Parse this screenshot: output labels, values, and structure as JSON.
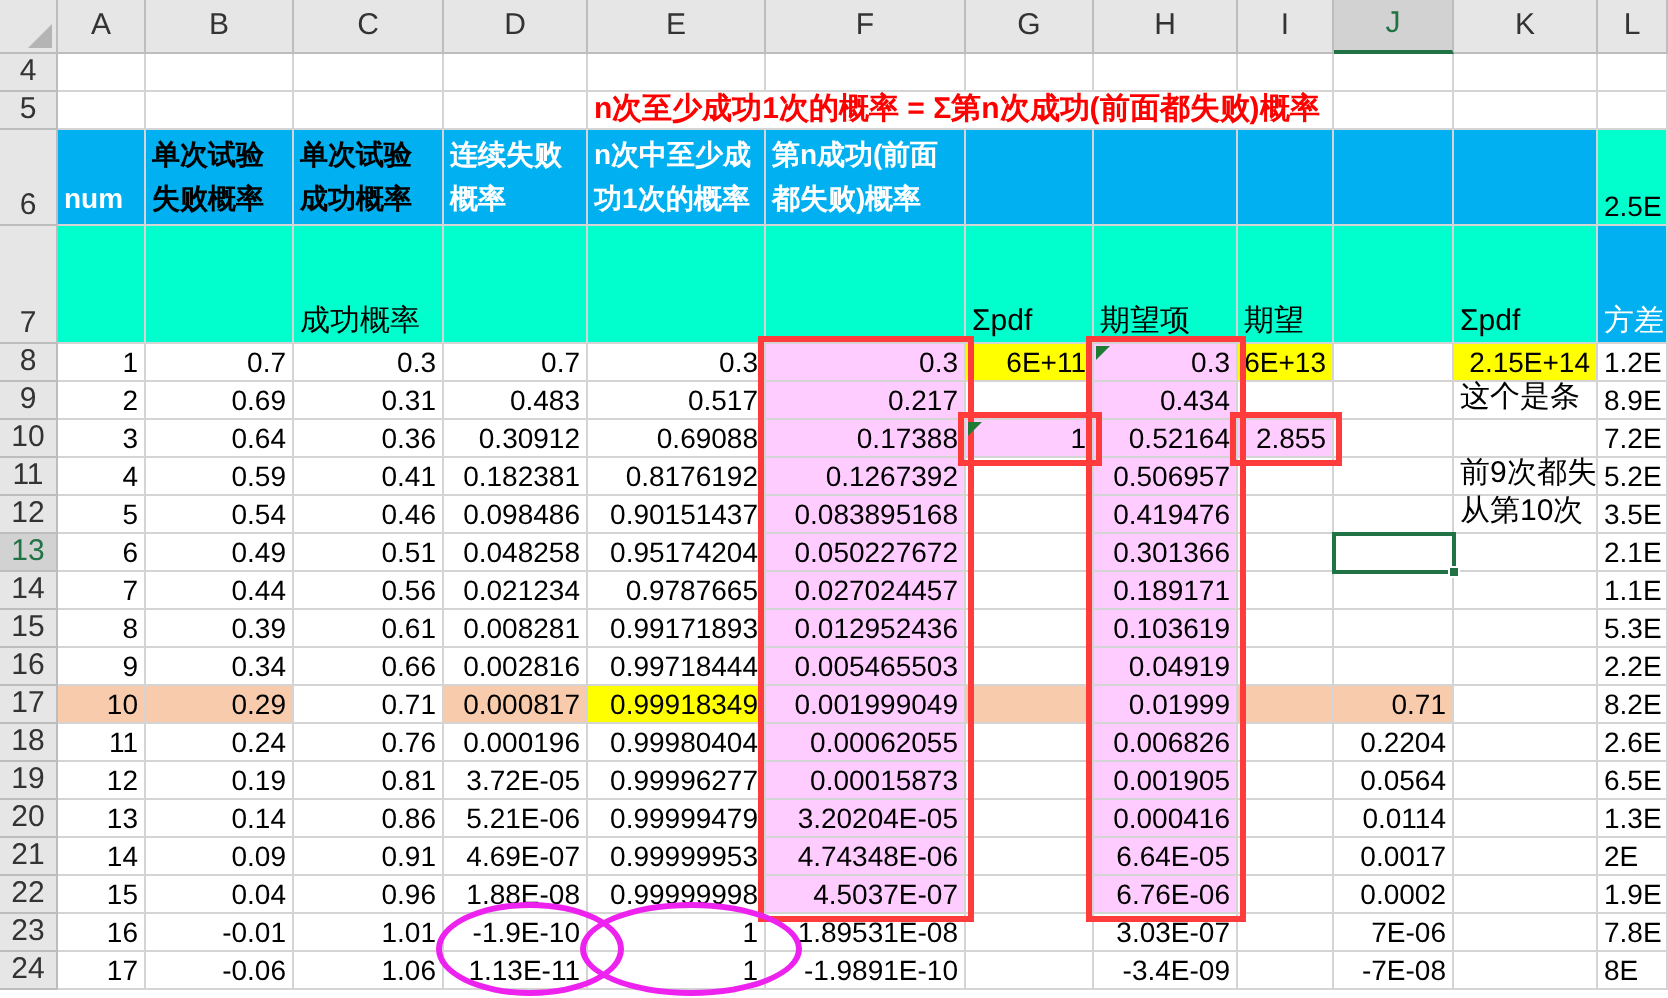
{
  "columns": [
    {
      "label": "A",
      "selected": false
    },
    {
      "label": "B",
      "selected": false
    },
    {
      "label": "C",
      "selected": false
    },
    {
      "label": "D",
      "selected": false
    },
    {
      "label": "E",
      "selected": false
    },
    {
      "label": "F",
      "selected": false
    },
    {
      "label": "G",
      "selected": false
    },
    {
      "label": "H",
      "selected": false
    },
    {
      "label": "I",
      "selected": false
    },
    {
      "label": "J",
      "selected": true
    },
    {
      "label": "K",
      "selected": false
    },
    {
      "label": "L",
      "selected": false
    }
  ],
  "rows": [
    {
      "num": "4",
      "selected": false,
      "cells": []
    },
    {
      "num": "5",
      "selected": false,
      "cells": [
        null,
        null,
        null,
        null,
        {
          "text": "n次至少成功1次的概率 = Σ第n次成功(前面都失败)概率",
          "kind": "title"
        }
      ]
    },
    {
      "num": "6",
      "selected": false,
      "cells": [
        {
          "text": "num",
          "kind": "header",
          "light_text": true,
          "color": "#00b0f0"
        },
        {
          "text": "单次试验失败概率",
          "kind": "header",
          "light_text": false,
          "color": "#00b0f0"
        },
        {
          "text": "单次试验成功概率",
          "kind": "header",
          "light_text": false,
          "color": "#00b0f0"
        },
        {
          "text": "连续失败概率",
          "kind": "header",
          "light_text": true,
          "color": "#00b0f0"
        },
        {
          "text": "n次中至少成功1次的概率",
          "kind": "header",
          "light_text": true,
          "color": "#00b0f0"
        },
        {
          "text": "第n成功(前面都失败)概率",
          "kind": "header",
          "light_text": true,
          "color": "#00b0f0"
        },
        {
          "color": "#00b0f0"
        },
        {
          "color": "#00b0f0"
        },
        {
          "color": "#00b0f0"
        },
        {
          "color": "#00b0f0"
        },
        {
          "color": "#00b0f0"
        },
        {
          "text": "2.5E",
          "kind": "clipped",
          "color": "#00ffcc"
        }
      ]
    },
    {
      "num": "7",
      "selected": false,
      "cells": [
        {
          "color": "#00ffcc"
        },
        {
          "color": "#00ffcc"
        },
        {
          "text": "成功概率",
          "kind": "label",
          "color": "#00ffcc"
        },
        {
          "color": "#00ffcc"
        },
        {
          "color": "#00ffcc"
        },
        {
          "color": "#00ffcc"
        },
        {
          "text": "Σpdf",
          "kind": "label",
          "color": "#00ffcc"
        },
        {
          "text": "期望项",
          "kind": "label",
          "color": "#00ffcc"
        },
        {
          "text": "期望",
          "kind": "label",
          "color": "#00ffcc"
        },
        {
          "color": "#00ffcc"
        },
        {
          "text": "Σpdf",
          "kind": "label",
          "color": "#00ffcc"
        },
        {
          "text": "方差",
          "kind": "label",
          "color": "#00b0f0",
          "light_text": true
        }
      ]
    },
    {
      "num": "8",
      "selected": false,
      "cells": [
        {
          "text": "1"
        },
        {
          "text": "0.7"
        },
        {
          "text": "0.3"
        },
        {
          "text": "0.7"
        },
        {
          "text": "0.3"
        },
        {
          "text": "0.3",
          "color": "#ffccff",
          "boxed": true
        },
        {
          "text": "6E+11",
          "color": "#ffff00"
        },
        {
          "text": "0.3",
          "color": "#ffccff",
          "flag": true,
          "boxed": true
        },
        {
          "text": "6E+13",
          "color": "#ffff00"
        },
        null,
        {
          "text": "2.15E+14",
          "color": "#ffff00"
        },
        {
          "text": "1.2E",
          "kind": "clipped"
        }
      ]
    },
    {
      "num": "9",
      "selected": false,
      "cells": [
        {
          "text": "2"
        },
        {
          "text": "0.69"
        },
        {
          "text": "0.31"
        },
        {
          "text": "0.483"
        },
        {
          "text": "0.517"
        },
        {
          "text": "0.217",
          "color": "#ffccff",
          "boxed": true
        },
        null,
        {
          "text": "0.434",
          "color": "#ffccff",
          "boxed": true
        },
        null,
        null,
        {
          "text": "这个是条",
          "kind": "label"
        },
        {
          "text": "8.9E",
          "kind": "clipped"
        }
      ]
    },
    {
      "num": "10",
      "selected": false,
      "cells": [
        {
          "text": "3"
        },
        {
          "text": "0.64"
        },
        {
          "text": "0.36"
        },
        {
          "text": "0.30912"
        },
        {
          "text": "0.69088"
        },
        {
          "text": "0.17388",
          "color": "#ffccff",
          "boxed": true
        },
        {
          "text": "1",
          "color": "#ffccff",
          "flag": true,
          "boxed": true
        },
        {
          "text": "0.52164",
          "color": "#ffccff",
          "boxed": true
        },
        {
          "text": "2.855",
          "color": "#ffccff",
          "boxed": true
        },
        null,
        null,
        {
          "text": "7.2E",
          "kind": "clipped"
        }
      ]
    },
    {
      "num": "11",
      "selected": false,
      "cells": [
        {
          "text": "4"
        },
        {
          "text": "0.59"
        },
        {
          "text": "0.41"
        },
        {
          "text": "0.182381"
        },
        {
          "text": "0.8176192"
        },
        {
          "text": "0.1267392",
          "color": "#ffccff",
          "boxed": true
        },
        null,
        {
          "text": "0.506957",
          "color": "#ffccff",
          "boxed": true
        },
        null,
        null,
        {
          "text": "前9次都失",
          "kind": "label"
        },
        {
          "text": "5.2E",
          "kind": "clipped"
        }
      ]
    },
    {
      "num": "12",
      "selected": false,
      "cells": [
        {
          "text": "5"
        },
        {
          "text": "0.54"
        },
        {
          "text": "0.46"
        },
        {
          "text": "0.098486"
        },
        {
          "text": "0.90151437"
        },
        {
          "text": "0.083895168",
          "color": "#ffccff",
          "boxed": true
        },
        null,
        {
          "text": "0.419476",
          "color": "#ffccff",
          "boxed": true
        },
        null,
        null,
        {
          "text": "从第10次",
          "kind": "label"
        },
        {
          "text": "3.5E",
          "kind": "clipped"
        }
      ]
    },
    {
      "num": "13",
      "selected": true,
      "cells": [
        {
          "text": "6"
        },
        {
          "text": "0.49"
        },
        {
          "text": "0.51"
        },
        {
          "text": "0.048258"
        },
        {
          "text": "0.95174204"
        },
        {
          "text": "0.050227672",
          "color": "#ffccff",
          "boxed": true
        },
        null,
        {
          "text": "0.301366",
          "color": "#ffccff",
          "boxed": true
        },
        null,
        {
          "selected": true
        },
        null,
        {
          "text": "2.1E",
          "kind": "clipped"
        }
      ]
    },
    {
      "num": "14",
      "selected": false,
      "cells": [
        {
          "text": "7"
        },
        {
          "text": "0.44"
        },
        {
          "text": "0.56"
        },
        {
          "text": "0.021234"
        },
        {
          "text": "0.9787665"
        },
        {
          "text": "0.027024457",
          "color": "#ffccff",
          "boxed": true
        },
        null,
        {
          "text": "0.189171",
          "color": "#ffccff",
          "boxed": true
        },
        null,
        null,
        null,
        {
          "text": "1.1E",
          "kind": "clipped"
        }
      ]
    },
    {
      "num": "15",
      "selected": false,
      "cells": [
        {
          "text": "8"
        },
        {
          "text": "0.39"
        },
        {
          "text": "0.61"
        },
        {
          "text": "0.008281"
        },
        {
          "text": "0.99171893"
        },
        {
          "text": "0.012952436",
          "color": "#ffccff",
          "boxed": true
        },
        null,
        {
          "text": "0.103619",
          "color": "#ffccff",
          "boxed": true
        },
        null,
        null,
        null,
        {
          "text": "5.3E",
          "kind": "clipped"
        }
      ]
    },
    {
      "num": "16",
      "selected": false,
      "cells": [
        {
          "text": "9"
        },
        {
          "text": "0.34"
        },
        {
          "text": "0.66"
        },
        {
          "text": "0.002816"
        },
        {
          "text": "0.99718444"
        },
        {
          "text": "0.005465503",
          "color": "#ffccff",
          "boxed": true
        },
        null,
        {
          "text": "0.04919",
          "color": "#ffccff",
          "boxed": true
        },
        null,
        null,
        null,
        {
          "text": "2.2E",
          "kind": "clipped"
        }
      ]
    },
    {
      "num": "17",
      "selected": false,
      "cells": [
        {
          "text": "10",
          "color": "#f8cbad"
        },
        {
          "text": "0.29",
          "color": "#f8cbad"
        },
        {
          "text": "0.71"
        },
        {
          "text": "0.000817",
          "color": "#f8cbad"
        },
        {
          "text": "0.99918349",
          "color": "#ffff00"
        },
        {
          "text": "0.001999049",
          "color": "#ffccff",
          "boxed": true
        },
        {
          "color": "#f8cbad"
        },
        {
          "text": "0.01999",
          "color": "#ffccff",
          "boxed": true
        },
        {
          "color": "#f8cbad"
        },
        {
          "text": "0.71",
          "color": "#f8cbad"
        },
        null,
        {
          "text": "8.2E",
          "kind": "clipped"
        }
      ]
    },
    {
      "num": "18",
      "selected": false,
      "cells": [
        {
          "text": "11"
        },
        {
          "text": "0.24"
        },
        {
          "text": "0.76"
        },
        {
          "text": "0.000196"
        },
        {
          "text": "0.99980404"
        },
        {
          "text": "0.00062055",
          "color": "#ffccff",
          "boxed": true
        },
        null,
        {
          "text": "0.006826",
          "color": "#ffccff",
          "boxed": true
        },
        null,
        {
          "text": "0.2204"
        },
        null,
        {
          "text": "2.6E",
          "kind": "clipped"
        }
      ]
    },
    {
      "num": "19",
      "selected": false,
      "cells": [
        {
          "text": "12"
        },
        {
          "text": "0.19"
        },
        {
          "text": "0.81"
        },
        {
          "text": "3.72E-05"
        },
        {
          "text": "0.99996277"
        },
        {
          "text": "0.00015873",
          "color": "#ffccff",
          "boxed": true
        },
        null,
        {
          "text": "0.001905",
          "color": "#ffccff",
          "boxed": true
        },
        null,
        {
          "text": "0.0564"
        },
        null,
        {
          "text": "6.5E",
          "kind": "clipped"
        }
      ]
    },
    {
      "num": "20",
      "selected": false,
      "cells": [
        {
          "text": "13"
        },
        {
          "text": "0.14"
        },
        {
          "text": "0.86"
        },
        {
          "text": "5.21E-06"
        },
        {
          "text": "0.99999479"
        },
        {
          "text": "3.20204E-05",
          "color": "#ffccff",
          "boxed": true
        },
        null,
        {
          "text": "0.000416",
          "color": "#ffccff",
          "boxed": true
        },
        null,
        {
          "text": "0.0114"
        },
        null,
        {
          "text": "1.3E",
          "kind": "clipped"
        }
      ]
    },
    {
      "num": "21",
      "selected": false,
      "cells": [
        {
          "text": "14"
        },
        {
          "text": "0.09"
        },
        {
          "text": "0.91"
        },
        {
          "text": "4.69E-07"
        },
        {
          "text": "0.99999953"
        },
        {
          "text": "4.74348E-06",
          "color": "#ffccff",
          "boxed": true
        },
        null,
        {
          "text": "6.64E-05",
          "color": "#ffccff",
          "boxed": true
        },
        null,
        {
          "text": "0.0017"
        },
        null,
        {
          "text": "2E",
          "kind": "clipped"
        }
      ]
    },
    {
      "num": "22",
      "selected": false,
      "cells": [
        {
          "text": "15"
        },
        {
          "text": "0.04"
        },
        {
          "text": "0.96"
        },
        {
          "text": "1.88E-08"
        },
        {
          "text": "0.99999998"
        },
        {
          "text": "4.5037E-07",
          "color": "#ffccff",
          "boxed": true
        },
        null,
        {
          "text": "6.76E-06",
          "color": "#ffccff",
          "boxed": true
        },
        null,
        {
          "text": "0.0002"
        },
        null,
        {
          "text": "1.9E",
          "kind": "clipped"
        }
      ]
    },
    {
      "num": "23",
      "selected": false,
      "cells": [
        {
          "text": "16"
        },
        {
          "text": "-0.01"
        },
        {
          "text": "1.01"
        },
        {
          "text": "-1.9E-10",
          "circled": true
        },
        {
          "text": "1",
          "circled": true
        },
        {
          "text": "1.89531E-08"
        },
        null,
        {
          "text": "3.03E-07"
        },
        null,
        {
          "text": "7E-06"
        },
        null,
        {
          "text": "7.8E",
          "kind": "clipped"
        }
      ]
    },
    {
      "num": "24",
      "selected": false,
      "cells": [
        {
          "text": "17"
        },
        {
          "text": "-0.06"
        },
        {
          "text": "1.06"
        },
        {
          "text": "1.13E-11",
          "circled": true
        },
        {
          "text": "1",
          "circled": true
        },
        {
          "text": "-1.9891E-10"
        },
        null,
        {
          "text": "-3.4E-09"
        },
        null,
        {
          "text": "-7E-08"
        },
        null,
        {
          "text": "8E",
          "kind": "clipped"
        }
      ]
    }
  ]
}
